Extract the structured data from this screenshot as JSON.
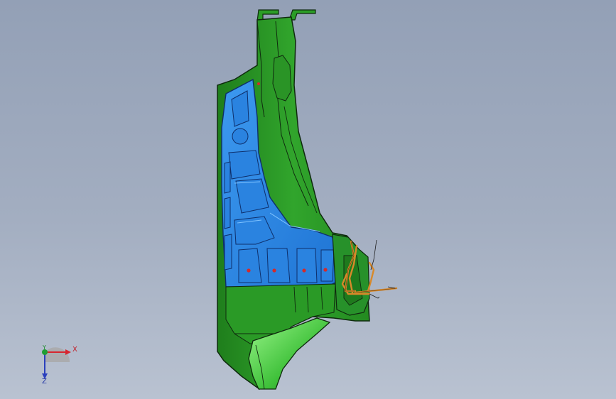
{
  "viewport": {
    "background_top": "#93a0b6",
    "background_bottom": "#b9c2d1"
  },
  "model": {
    "colors": {
      "green_body": "#2ea52a",
      "green_dark": "#1b6f18",
      "green_light": "#79e86a",
      "blue_face": "#2f8ae6",
      "blue_light": "#5eb2ff",
      "orange_wire": "#d8892a",
      "red_marker": "#d42a2a",
      "outline": "#0f2a0e"
    }
  },
  "triad": {
    "x_label": "X",
    "y_label": "Y",
    "z_label": "Z",
    "x_color": "#d7262e",
    "y_color": "#1f9e33",
    "z_color": "#2a3fbd"
  }
}
